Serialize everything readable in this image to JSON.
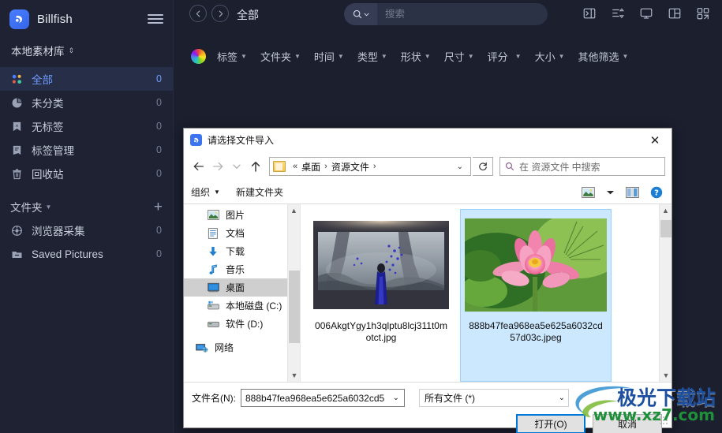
{
  "app": {
    "brand": "Billfish",
    "library_label": "本地素材库",
    "menu_icon": "hamburger-icon"
  },
  "sidebar": {
    "items": [
      {
        "label": "全部",
        "count": "0",
        "icon": "dots-grid-icon",
        "active": true
      },
      {
        "label": "未分类",
        "count": "0",
        "icon": "pie-chart-icon",
        "active": false
      },
      {
        "label": "无标签",
        "count": "0",
        "icon": "tag-off-icon",
        "active": false
      },
      {
        "label": "标签管理",
        "count": "0",
        "icon": "tag-manage-icon",
        "active": false
      },
      {
        "label": "回收站",
        "count": "0",
        "icon": "trash-icon",
        "active": false
      }
    ],
    "folder_section": {
      "title": "文件夹",
      "add_label": "+",
      "items": [
        {
          "label": "浏览器采集",
          "count": "0",
          "icon": "browser-capture-icon"
        },
        {
          "label": "Saved Pictures",
          "count": "0",
          "icon": "folder-icon"
        }
      ]
    }
  },
  "topbar": {
    "back_icon": "chevron-left-icon",
    "forward_icon": "chevron-right-icon",
    "breadcrumb": "全部",
    "search": {
      "placeholder": "搜索",
      "value": ""
    },
    "tools": [
      {
        "name": "panel-toggle-icon"
      },
      {
        "name": "sort-icon"
      },
      {
        "name": "display-icon"
      },
      {
        "name": "grid-layout-icon"
      },
      {
        "name": "masonry-layout-icon"
      }
    ]
  },
  "filterbar": {
    "color_wheel_icon": "color-wheel-icon",
    "filters": [
      {
        "label": "标签"
      },
      {
        "label": "文件夹"
      },
      {
        "label": "时间"
      },
      {
        "label": "类型"
      },
      {
        "label": "形状"
      },
      {
        "label": "尺寸"
      },
      {
        "label": "评分"
      },
      {
        "label": "大小"
      },
      {
        "label": "其他筛选"
      }
    ]
  },
  "dialog": {
    "title": "请选择文件导入",
    "close_label": "✕",
    "nav": {
      "back_icon": "arrow-left-icon",
      "forward_icon": "arrow-right-icon",
      "recent_icon": "chevron-down-icon",
      "up_icon": "arrow-up-icon"
    },
    "breadcrumb": {
      "prefix": "«",
      "segments": [
        "桌面",
        "资源文件"
      ],
      "dropdown_icon": "chevron-down-icon",
      "refresh_icon": "refresh-icon"
    },
    "search": {
      "placeholder": "在 资源文件 中搜索",
      "icon": "search-icon"
    },
    "commands": {
      "organize": "组织",
      "new_folder": "新建文件夹",
      "view_icon": "view-mode-icon",
      "view_caret": "▼",
      "preview_pane_icon": "preview-pane-icon",
      "help_icon": "help-icon"
    },
    "tree": [
      {
        "label": "图片",
        "icon": "pictures-icon",
        "selected": false
      },
      {
        "label": "文档",
        "icon": "documents-icon",
        "selected": false
      },
      {
        "label": "下载",
        "icon": "downloads-icon",
        "selected": false
      },
      {
        "label": "音乐",
        "icon": "music-icon",
        "selected": false
      },
      {
        "label": "桌面",
        "icon": "desktop-icon",
        "selected": true
      },
      {
        "label": "本地磁盘 (C:)",
        "icon": "drive-icon",
        "selected": false
      },
      {
        "label": "软件 (D:)",
        "icon": "drive-icon",
        "selected": false
      },
      {
        "label": "网络",
        "icon": "network-icon",
        "selected": false,
        "root": true
      }
    ],
    "files": [
      {
        "name": "006AkgtYgy1h3qlptu8lcj311t0motct.jpg",
        "selected": false,
        "thumb": "dark-forest-scene"
      },
      {
        "name": "888b47fea968ea5e625a6032cd57d03c.jpeg",
        "selected": true,
        "thumb": "pink-lotus-flower"
      }
    ],
    "footer": {
      "filename_label": "文件名(N):",
      "filename_value": "888b47fea968ea5e625a6032cd5",
      "filetype_value": "所有文件 (*)",
      "open_button": "打开(O)",
      "cancel_button": "取消"
    }
  },
  "watermark": {
    "text_cn": "极光下载站",
    "text_url": "www.xz7.com"
  },
  "colors": {
    "sidebar_bg": "#1e2232",
    "accent_blue": "#6f9cff",
    "active_row": "#272e47",
    "dialog_selection": "#cce8ff",
    "primary_border": "#0078d7"
  }
}
